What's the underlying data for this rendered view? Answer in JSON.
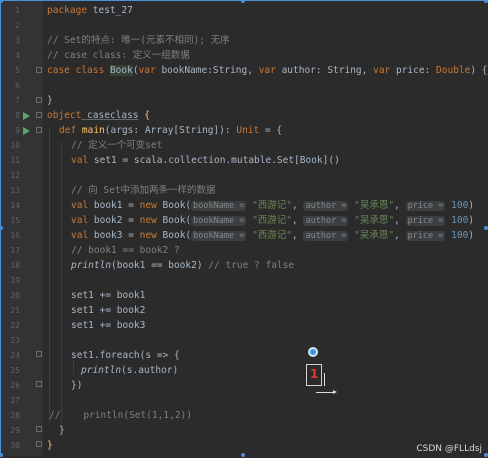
{
  "editor": {
    "lines": [
      {
        "n": "1"
      },
      {
        "n": "2"
      },
      {
        "n": "3"
      },
      {
        "n": "4"
      },
      {
        "n": "5"
      },
      {
        "n": "6"
      },
      {
        "n": "7"
      },
      {
        "n": "8"
      },
      {
        "n": "9"
      },
      {
        "n": "10"
      },
      {
        "n": "11"
      },
      {
        "n": "12"
      },
      {
        "n": "13"
      },
      {
        "n": "14"
      },
      {
        "n": "15"
      },
      {
        "n": "16"
      },
      {
        "n": "17"
      },
      {
        "n": "18"
      },
      {
        "n": "19"
      },
      {
        "n": "20"
      },
      {
        "n": "21"
      },
      {
        "n": "22"
      },
      {
        "n": "23"
      },
      {
        "n": "24"
      },
      {
        "n": "25"
      },
      {
        "n": "26"
      },
      {
        "n": "27"
      },
      {
        "n": "28"
      },
      {
        "n": "29"
      },
      {
        "n": "30"
      }
    ],
    "t": {
      "package": "package",
      "pkgname": " test_27",
      "c3": "// Set的特点: 唯一(元素不相同); 无序",
      "c4": "// case class: 定义一组数据",
      "case": "case",
      "class": " class ",
      "Book": "Book",
      "l5a": "(",
      "var": "var",
      "l5b": " bookName:String, ",
      "l5c": " author: String, ",
      "l5d": " price: ",
      "Double": "Double",
      "l5e": ") {",
      "rbrace": "}",
      "object": "object",
      "caseclass": " caseclass",
      "lbrace": " {",
      "def": "def",
      "main": " main",
      "l9a": "(args: Array[String]): ",
      "Unit": "Unit",
      "l9b": " = {",
      "c10": "// 定义一个可变set",
      "val": "val",
      "l11": " set1 = scala.collection.mutable.Set[Book]()",
      "c13": "// 向 Set中添加两条一样的数据",
      "book1": " book1 = ",
      "book2": " book2 = ",
      "book3": " book3 = ",
      "new": "new",
      "BookCall": " Book(",
      "hintName": "bookName =",
      "s1": "\"西游记\"",
      "comma": ", ",
      "hintAuthor": "author =",
      "s2": "\"吴承恩\"",
      "hintPrice": "price =",
      "p100": "100",
      "rparen": ")",
      "c17": "// book1 == book2 ?",
      "println": "println",
      "l18": "(book1 == book2) ",
      "c18": "// true ? false",
      "l20": "set1 += book1",
      "l21": "set1 += book2",
      "l22": "set1 += book3",
      "l24": "set1.foreach(s => {",
      "l25": "(s.author)",
      "l26": "})",
      "c28a": "//",
      "c28b": "    println(Set(1,1,2))"
    }
  },
  "overlay": {
    "marker_label": "1"
  },
  "watermark": "CSDN @FLLdsj",
  "colors": {
    "keyword": "#cc7832",
    "function": "#ffc66d",
    "string": "#6a8759",
    "number": "#6897bb",
    "comment": "#808080"
  }
}
